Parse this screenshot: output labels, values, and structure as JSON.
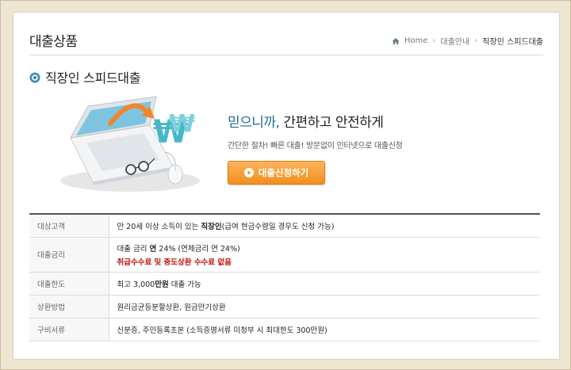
{
  "header": {
    "title": "대출상품",
    "breadcrumb": [
      "Home",
      "대출안내",
      "직장인 스피드대출"
    ]
  },
  "section": {
    "title": "직장인 스피드대출"
  },
  "promo": {
    "headline_accent": "믿으니까,",
    "headline_rest": " 간편하고 안전하게",
    "sub": "간단한 절차! 빠른 대출! 방문없이 인터넷으로 대출신청",
    "apply_button": "대출신청하기"
  },
  "table": {
    "rows": [
      {
        "label": "대상고객",
        "value_pre": "만 20세 이상 소득이 있는 ",
        "value_bold": "직장인",
        "value_post": "(급여 현금수령일 경우도 신청 가능)"
      },
      {
        "label": "대출금리",
        "value_pre": "대출 금리 ",
        "value_bold": "연",
        "value_post": " 24% (연체금리 연 24%)",
        "value_line2": "취급수수료 및 중도상환 수수료 없음"
      },
      {
        "label": "대출한도",
        "value_pre": "최고 3,000",
        "value_bold": "만원",
        "value_post": " 대출 가능"
      },
      {
        "label": "상환방법",
        "value_pre": "원리금균등분할상환, 원금만기상환",
        "value_bold": "",
        "value_post": ""
      },
      {
        "label": "구비서류",
        "value_pre": "신분증, 주민등록초본 (소득증명서류 미청부 시 최대한도 300만원)",
        "value_bold": "",
        "value_post": ""
      }
    ]
  },
  "colors": {
    "accent": "#1f6b8a",
    "button": "#f28f1e",
    "warning": "#c0140c",
    "background": "#efe6d2"
  },
  "icons": {
    "home": "home-icon",
    "bullet": "bullet-icon",
    "button": "play-icon"
  }
}
